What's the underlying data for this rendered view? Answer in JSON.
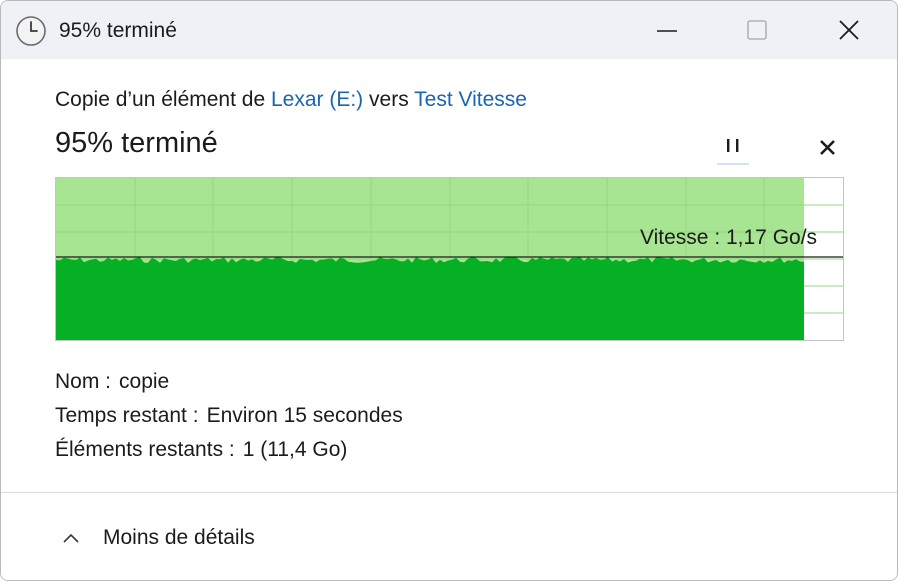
{
  "window": {
    "title": "95% terminé",
    "icons": {
      "title": "clock-icon",
      "minimize": "minimize-icon",
      "maximize": "maximize-icon",
      "close": "close-icon"
    }
  },
  "copy_info": {
    "prefix": "Copie d’un élément de ",
    "source": "Lexar (E:)",
    "middle": " vers ",
    "destination": "Test Vitesse"
  },
  "progress": {
    "title": "95% terminé",
    "percent": 95,
    "pause_icon": "pause-icon",
    "cancel_icon": "cancel-x-icon"
  },
  "speed": {
    "label": "Vitesse : 1,17 Go/s"
  },
  "details": {
    "name_label": "Nom :",
    "name_value": "copie",
    "time_label": "Temps restant :",
    "time_value": "Environ 15 secondes",
    "items_label": "Éléments restants :",
    "items_value": "1 (11,4 Go)"
  },
  "footer": {
    "toggle_label": "Moins de détails",
    "toggle_icon": "chevron-up-icon"
  },
  "colors": {
    "progress_fill": "#a8e593",
    "throughput_fill": "#06b025",
    "link": "#1a64b0",
    "titlebar": "#eef1f6"
  }
}
